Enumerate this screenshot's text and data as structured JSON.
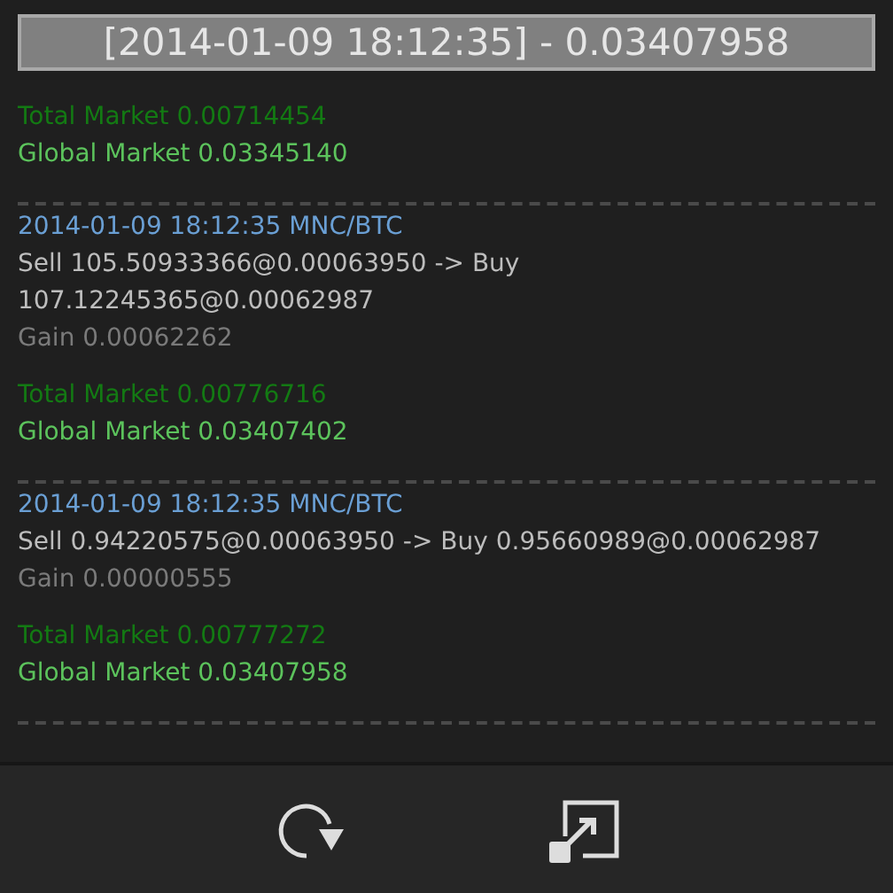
{
  "header": {
    "title": "[2014-01-09 18:12:35] - 0.03407958"
  },
  "entries": [
    {
      "total": "Total Market 0.00714454",
      "global": "Global Market 0.03345140"
    },
    {
      "trade": {
        "title": "2014-01-09 18:12:35 MNC/BTC",
        "order": "Sell 105.50933366@0.00063950 -> Buy 107.12245365@0.00062987",
        "gain": "Gain 0.00062262"
      },
      "total": "Total Market 0.00776716",
      "global": "Global Market 0.03407402"
    },
    {
      "trade": {
        "title": "2014-01-09 18:12:35 MNC/BTC",
        "order": "Sell 0.94220575@0.00063950 -> Buy 0.95660989@0.00062987",
        "gain": "Gain 0.00000555"
      },
      "total": "Total Market 0.00777272",
      "global": "Global Market 0.03407958"
    }
  ],
  "toolbar": [
    {
      "kind": "refresh"
    },
    {
      "kind": "popout"
    }
  ]
}
